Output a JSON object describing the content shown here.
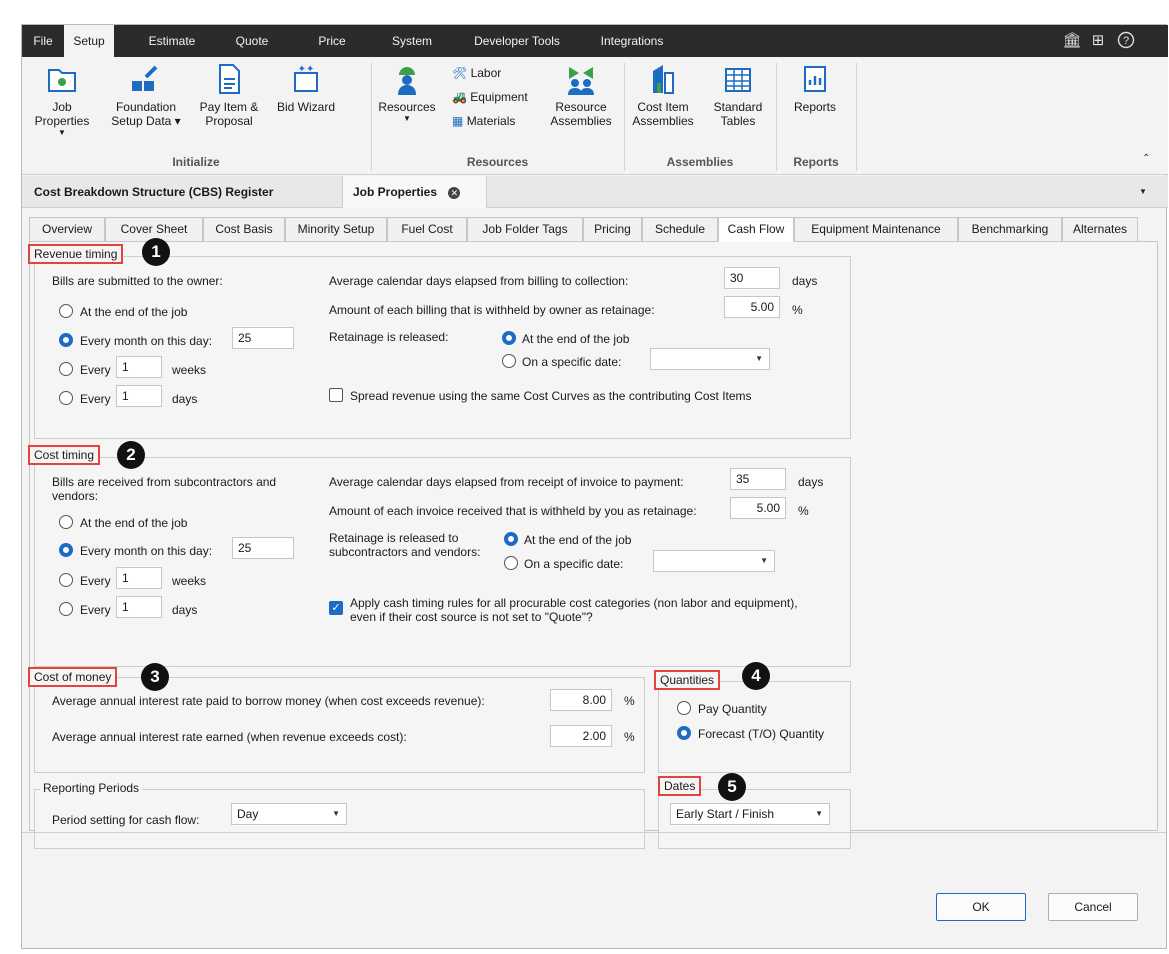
{
  "menu": {
    "tabs": [
      {
        "label": "File"
      },
      {
        "label": "Setup"
      },
      {
        "label": "Estimate"
      },
      {
        "label": "Quote"
      },
      {
        "label": "Price"
      },
      {
        "label": "System"
      },
      {
        "label": "Developer Tools"
      },
      {
        "label": "Integrations"
      }
    ],
    "active": "Setup",
    "icons": [
      "bank-icon",
      "grid-icon",
      "help-icon"
    ]
  },
  "ribbon": {
    "initialize": {
      "group_label": "Initialize",
      "job_properties": "Job Properties",
      "foundation_1": "Foundation",
      "foundation_2": "Setup Data",
      "payitem_1": "Pay Item &",
      "payitem_2": "Proposal",
      "bid_wizard": "Bid Wizard"
    },
    "resources": {
      "group_label": "Resources",
      "resources": "Resources",
      "labor": "Labor",
      "equipment": "Equipment",
      "materials": "Materials",
      "res_asm_1": "Resource",
      "res_asm_2": "Assemblies"
    },
    "assemblies": {
      "group_label": "Assemblies",
      "cost_item_1": "Cost Item",
      "cost_item_2": "Assemblies",
      "std_tables_1": "Standard",
      "std_tables_2": "Tables"
    },
    "reports": {
      "group_label": "Reports",
      "reports": "Reports"
    }
  },
  "doc_tabs": {
    "cbs": "Cost Breakdown Structure (CBS) Register",
    "job_props": "Job Properties"
  },
  "prop_tabs": [
    "Overview",
    "Cover Sheet",
    "Cost Basis",
    "Minority Setup",
    "Fuel Cost",
    "Job Folder Tags",
    "Pricing",
    "Schedule",
    "Cash Flow",
    "Equipment Maintenance",
    "Benchmarking",
    "Alternates"
  ],
  "revenue": {
    "title": "Revenue timing",
    "callout": "1",
    "bills_label": "Bills are submitted to the owner:",
    "opt_end": "At the end of the job",
    "opt_month": "Every month on this day:",
    "month_day": "25",
    "opt_every": "Every",
    "weeks_value": "1",
    "weeks": "weeks",
    "days_value": "1",
    "days": "days",
    "avg_days_label": "Average calendar days elapsed from billing to collection:",
    "avg_days_value": "30",
    "days_unit": "days",
    "withheld_label": "Amount of each billing that is withheld by owner as retainage:",
    "withheld_value": "5.00",
    "pct": "%",
    "retainage_label": "Retainage is released:",
    "ret_end": "At the end of the job",
    "ret_specific": "On a specific date:",
    "spread_label": "Spread revenue using the same Cost Curves as the contributing Cost Items"
  },
  "cost": {
    "title": "Cost timing",
    "callout": "2",
    "bills_label_1": "Bills are received from subcontractors and",
    "bills_label_2": "vendors:",
    "opt_end": "At the end of the job",
    "opt_month": "Every month on this day:",
    "month_day": "25",
    "opt_every": "Every",
    "weeks_value": "1",
    "weeks": "weeks",
    "days_value": "1",
    "days": "days",
    "avg_days_label": "Average calendar days elapsed from receipt of invoice to payment:",
    "avg_days_value": "35",
    "days_unit": "days",
    "withheld_label": "Amount of each invoice received that is withheld by you as retainage:",
    "withheld_value": "5.00",
    "pct": "%",
    "retainage_label_1": "Retainage is released to",
    "retainage_label_2": "subcontractors and vendors:",
    "ret_end": "At the end of the job",
    "ret_specific": "On a specific date:",
    "apply_label_1": "Apply cash timing rules for all procurable cost categories (non labor and equipment),",
    "apply_label_2": "even if their cost source is not set to \"Quote\"?"
  },
  "money": {
    "title": "Cost of money",
    "callout": "3",
    "borrow_label": "Average annual interest rate paid to borrow money (when cost exceeds revenue):",
    "borrow_value": "8.00",
    "earn_label": "Average annual interest rate earned (when revenue exceeds cost):",
    "earn_value": "2.00",
    "pct": "%"
  },
  "quantities": {
    "title": "Quantities",
    "callout": "4",
    "pay": "Pay Quantity",
    "forecast": "Forecast (T/O) Quantity"
  },
  "reporting": {
    "title": "Reporting Periods",
    "period_label": "Period setting for cash flow:",
    "period_value": "Day"
  },
  "dates": {
    "title": "Dates",
    "callout": "5",
    "value": "Early Start / Finish"
  },
  "footer": {
    "ok": "OK",
    "cancel": "Cancel"
  },
  "colors": {
    "accent": "#1e6bc4",
    "highlight": "#e2443f",
    "menubar": "#2b2b2b"
  }
}
